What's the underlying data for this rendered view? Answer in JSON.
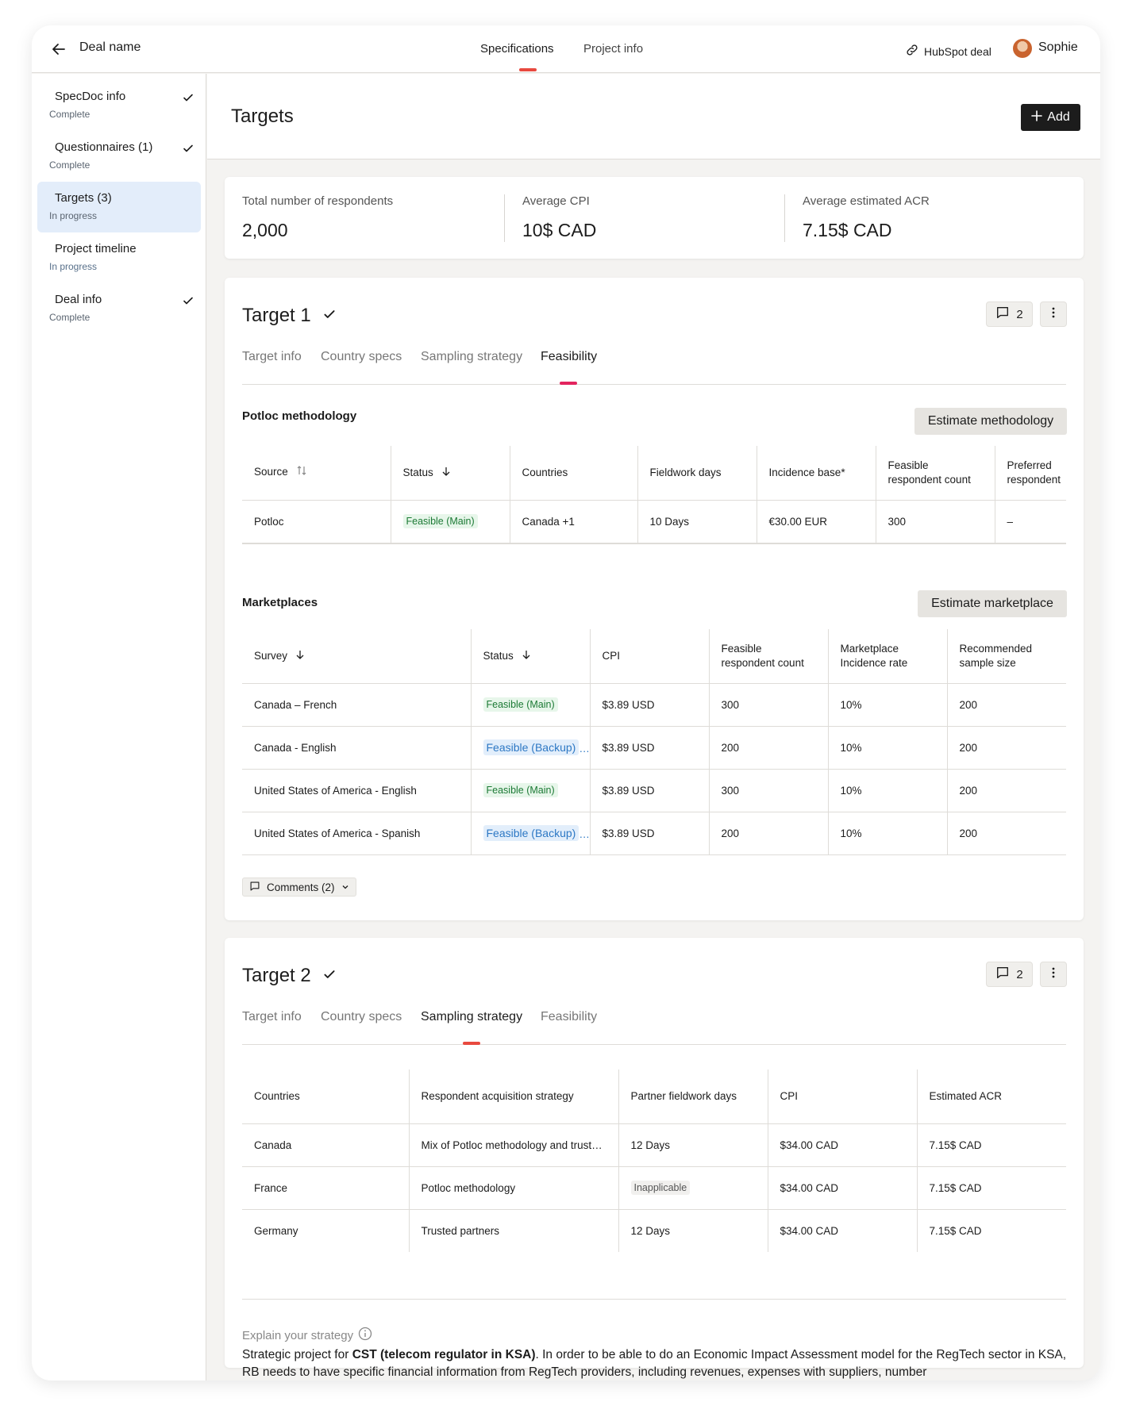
{
  "header": {
    "deal_name": "Deal name",
    "tabs": [
      {
        "label": "Specifications"
      },
      {
        "label": "Project info"
      }
    ],
    "hubspot_label": "HubSpot deal",
    "user_name": "Sophie"
  },
  "sidebar": {
    "items": [
      {
        "label": "SpecDoc info",
        "status": "Complete"
      },
      {
        "label": "Questionnaires (1)",
        "status": "Complete"
      },
      {
        "label": "Targets (3)",
        "status": "In progress"
      },
      {
        "label": "Project timeline",
        "status": "In progress"
      },
      {
        "label": "Deal info",
        "status": "Complete"
      }
    ]
  },
  "page": {
    "title": "Targets",
    "add_label": "Add"
  },
  "summary": {
    "total_label": "Total number of respondents",
    "total_value": "2,000",
    "cpi_label": "Average CPI",
    "cpi_value": "10$ CAD",
    "acr_label": "Average estimated ACR",
    "acr_value": "7.15$ CAD"
  },
  "target1": {
    "title": "Target 1",
    "comment_count": "2",
    "tabs": [
      "Target info",
      "Country specs",
      "Sampling strategy",
      "Feasibility"
    ],
    "methodology": {
      "title": "Potloc methodology",
      "button": "Estimate methodology",
      "headers": [
        "Source",
        "Status",
        "Countries",
        "Fieldwork days",
        "Incidence base*",
        "Feasible respondent count",
        "Preferred respondent"
      ],
      "row": [
        "Potloc",
        "Feasible (Main)",
        "Canada +1",
        "10 Days",
        "€30.00 EUR",
        "300",
        "–"
      ]
    },
    "marketplaces": {
      "title": "Marketplaces",
      "button": "Estimate marketplace",
      "headers": [
        "Survey",
        "Status",
        "CPI",
        "Feasible respondent count",
        "Marketplace Incidence rate",
        "Recommended sample size"
      ],
      "rows": [
        [
          "Canada – French",
          "Feasible (Main)",
          "$3.89 USD",
          "300",
          "10%",
          "200"
        ],
        [
          "Canada - English",
          "Feasible (Backup)",
          "$3.89 USD",
          "200",
          "10%",
          "200"
        ],
        [
          "United States of America - English",
          "Feasible (Main)",
          "$3.89 USD",
          "300",
          "10%",
          "200"
        ],
        [
          "United States of America - Spanish",
          "Feasible (Backup)",
          "$3.89 USD",
          "200",
          "10%",
          "200"
        ]
      ]
    },
    "comments_label": "Comments (2)"
  },
  "target2": {
    "title": "Target 2",
    "comment_count": "2",
    "tabs": [
      "Target info",
      "Country specs",
      "Sampling strategy",
      "Feasibility"
    ],
    "headers": [
      "Countries",
      "Respondent acquisition strategy",
      "Partner fieldwork days",
      "CPI",
      "Estimated ACR"
    ],
    "rows": [
      [
        "Canada",
        "Mix of Potloc methodology and trusted partners",
        "12 Days",
        "$34.00 CAD",
        "7.15$ CAD"
      ],
      [
        "France",
        "Potloc methodology",
        "Inapplicable",
        "$34.00 CAD",
        "7.15$ CAD"
      ],
      [
        "Germany",
        "Trusted partners",
        "12 Days",
        "$34.00 CAD",
        "7.15$ CAD"
      ]
    ],
    "explain_label": "Explain your strategy",
    "explain_pre": "Strategic project for ",
    "explain_bold": "CST (telecom regulator in KSA)",
    "explain_post": ". In order to be able to do an Economic Impact Assessment model for the RegTech sector in KSA, RB needs to have specific financial information from RegTech providers, including revenues, expenses with suppliers, number"
  },
  "colors": {
    "accent": "#e8493f",
    "active_sidebar": "#e3edfa",
    "feasible_main": "#1c7a35",
    "feasible_backup": "#2d78c4"
  }
}
